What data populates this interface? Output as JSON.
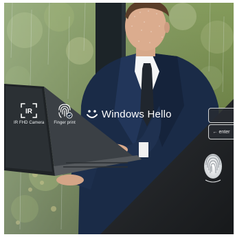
{
  "features": [
    {
      "label": "IR FHD Camera",
      "icon": "ir-camera-icon"
    },
    {
      "label": "Finger print",
      "icon": "fingerprint-icon"
    }
  ],
  "windows_hello": {
    "label": "Windows Hello",
    "icon": "smiley-icon"
  },
  "keyboard": {
    "enter_label": "enter"
  },
  "colors": {
    "overlay_text": "#ffffff",
    "dark_panel": "#232628",
    "suit": "#1a2b47"
  }
}
